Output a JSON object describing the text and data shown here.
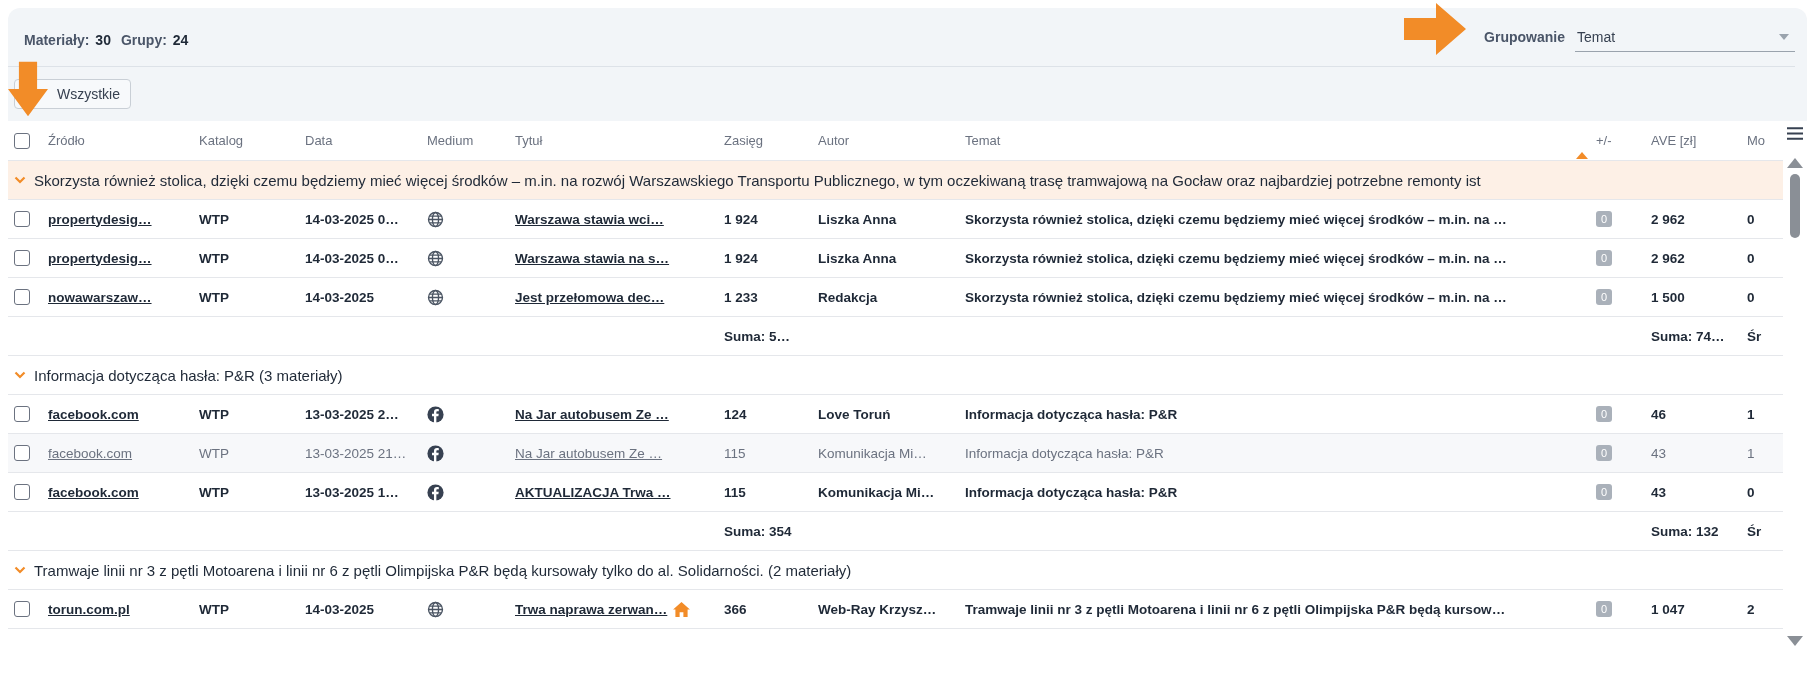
{
  "summary": {
    "materials_label": "Materiały:",
    "materials": "30",
    "groups_label": "Grupy:",
    "groups": "24"
  },
  "grouping": {
    "label": "Grupowanie",
    "value": "Temat"
  },
  "filter_button": "Wszystkie",
  "select_all": {
    "checked": false
  },
  "columns": [
    {
      "label": "Źródło",
      "sorted": false
    },
    {
      "label": "Katalog",
      "sorted": false
    },
    {
      "label": "Data",
      "sorted": false
    },
    {
      "label": "Medium",
      "sorted": false
    },
    {
      "label": "Tytuł",
      "sorted": false
    },
    {
      "label": "Zasięg",
      "sorted": false
    },
    {
      "label": "Autor",
      "sorted": false
    },
    {
      "label": "Temat",
      "sorted": true
    },
    {
      "label": "+/-",
      "sorted": false
    },
    {
      "label": "AVE [zł]",
      "sorted": false
    },
    {
      "label": "Mo",
      "sorted": false
    }
  ],
  "groups": [
    {
      "title": "Skorzysta również stolica, dzięki czemu będziemy mieć więcej środków – m.in. na rozwój Warszawskiego Transportu Publicznego, w tym oczekiwaną trasę tramwajową na Gocław oraz najbardziej potrzebne remonty ist",
      "expanded": true,
      "highlighted": true,
      "rows": [
        {
          "checked": false,
          "faded": false,
          "source": "propertydesig…",
          "catalog": "WTP",
          "date": "14-03-2025 0…",
          "kind": "web",
          "title": "Warszawa stawia wci…",
          "home": false,
          "reach": "1 924",
          "author": "Liszka Anna",
          "topic": "Skorzysta również stolica, dzięki czemu będziemy mieć więcej środków – m.in. na …",
          "delta": "0",
          "ave": "2 962",
          "column_12": "0"
        },
        {
          "checked": false,
          "faded": false,
          "source": "propertydesig…",
          "catalog": "WTP",
          "date": "14-03-2025 0…",
          "kind": "web",
          "title": "Warszawa stawia na s…",
          "home": false,
          "reach": "1 924",
          "author": "Liszka Anna",
          "topic": "Skorzysta również stolica, dzięki czemu będziemy mieć więcej środków – m.in. na …",
          "delta": "0",
          "ave": "2 962",
          "column_12": "0"
        },
        {
          "checked": false,
          "faded": false,
          "source": "nowawarszaw…",
          "catalog": "WTP",
          "date": "14-03-2025",
          "kind": "web",
          "title": "Jest przełomowa dec…",
          "home": false,
          "reach": "1 233",
          "author": "Redakcja",
          "topic": "Skorzysta również stolica, dzięki czemu będziemy mieć więcej środków – m.in. na …",
          "delta": "0",
          "ave": "1 500",
          "column_12": "0"
        }
      ],
      "totals": {
        "reach": "Suma: 5…",
        "ave": "Suma: 74…",
        "column_12": "Śr"
      }
    },
    {
      "title": "Informacja dotycząca hasła: P&R (3 materiały)",
      "expanded": true,
      "highlighted": false,
      "rows": [
        {
          "checked": false,
          "faded": false,
          "source": "facebook.com",
          "catalog": "WTP",
          "date": "13-03-2025 2…",
          "kind": "facebook",
          "title": "Na Jar autobusem Ze …",
          "home": false,
          "reach": "124",
          "author": "Love Toruń",
          "topic": "Informacja dotycząca hasła: P&R",
          "delta": "0",
          "ave": "46",
          "column_12": "1"
        },
        {
          "checked": false,
          "faded": true,
          "source": "facebook.com",
          "catalog": "WTP",
          "date": "13-03-2025 21…",
          "kind": "facebook",
          "title": "Na Jar autobusem Ze …",
          "home": false,
          "reach": "115",
          "author": "Komunikacja Mi…",
          "topic": "Informacja dotycząca hasła: P&R",
          "delta": "0",
          "ave": "43",
          "column_12": "1"
        },
        {
          "checked": false,
          "faded": false,
          "source": "facebook.com",
          "catalog": "WTP",
          "date": "13-03-2025 1…",
          "kind": "facebook",
          "title": "AKTUALIZACJA Trwa …",
          "home": false,
          "reach": "115",
          "author": "Komunikacja Mi…",
          "topic": "Informacja dotycząca hasła: P&R",
          "delta": "0",
          "ave": "43",
          "column_12": "0"
        }
      ],
      "totals": {
        "reach": "Suma: 354",
        "ave": "Suma: 132",
        "column_12": "Śr"
      }
    },
    {
      "title": "Tramwaje linii nr 3 z pętli Motoarena i linii nr 6 z pętli Olimpijska P&R będą kursowały tylko do al. Solidarności. (2 materiały)",
      "expanded": true,
      "highlighted": false,
      "rows": [
        {
          "checked": false,
          "faded": false,
          "source": "torun.com.pl",
          "catalog": "WTP",
          "date": "14-03-2025",
          "kind": "web",
          "title": "Trwa naprawa zerwan…",
          "home": true,
          "reach": "366",
          "author": "Web-Ray Krzysz…",
          "topic": "Tramwaje linii nr 3 z pętli Motoarena i linii nr 6 z pętli Olimpijska P&R będą kursow…",
          "delta": "0",
          "ave": "1 047",
          "column_12": "2"
        }
      ]
    }
  ]
}
